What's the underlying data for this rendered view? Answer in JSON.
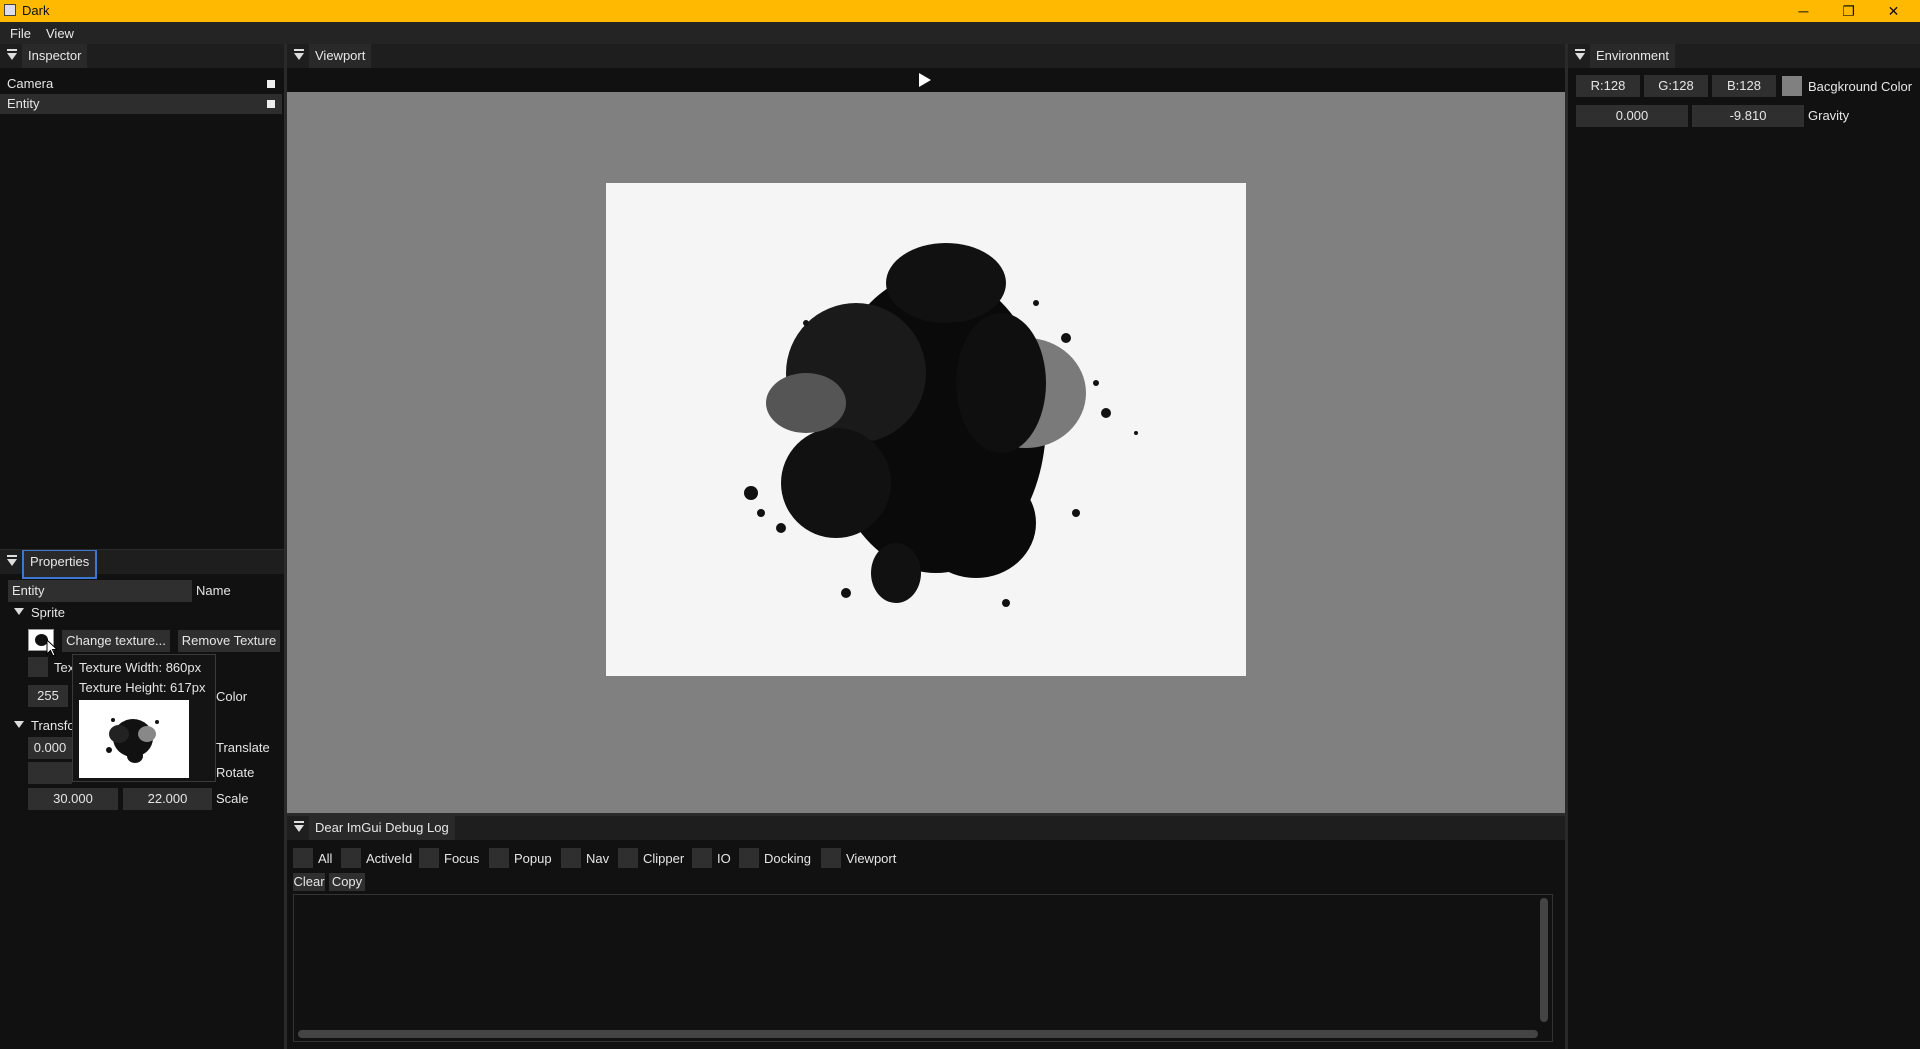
{
  "window": {
    "title": "Dark"
  },
  "menu": {
    "items": [
      "File",
      "View"
    ]
  },
  "inspector": {
    "tab": "Inspector",
    "items": [
      "Camera",
      "Entity"
    ]
  },
  "viewport": {
    "tab": "Viewport"
  },
  "environment": {
    "tab": "Environment",
    "r": "R:128",
    "g": "G:128",
    "b": "B:128",
    "bg_label": "Bacgkround Color",
    "gravity_x": "0.000",
    "gravity_y": "-9.810",
    "gravity_label": "Gravity",
    "bg_swatch_color": "#808080"
  },
  "properties": {
    "tab": "Properties",
    "name_value": "Entity",
    "name_label": "Name",
    "sprite_header": "Sprite",
    "change_texture": "Change texture...",
    "remove_texture": "Remove Texture",
    "tex_partial": "Tex",
    "color_value": "255",
    "color_label": "Color",
    "transform_header": "Transfo",
    "translate_x": "0.000",
    "translate_label": "Translate",
    "rotate_label": "Rotate",
    "scale_x": "30.000",
    "scale_y": "22.000",
    "scale_label": "Scale"
  },
  "tooltip": {
    "width_text": "Texture Width:  860px",
    "height_text": "Texture Height: 617px"
  },
  "debug_log": {
    "tab": "Dear ImGui Debug Log",
    "filters": [
      "All",
      "ActiveId",
      "Focus",
      "Popup",
      "Nav",
      "Clipper",
      "IO",
      "Docking",
      "Viewport"
    ],
    "clear": "Clear",
    "copy": "Copy"
  },
  "colors": {
    "titlebar": "#ffb900",
    "viewport_bg": "#808080",
    "panel_bg": "#111111",
    "focus_border": "#3a78d4"
  }
}
